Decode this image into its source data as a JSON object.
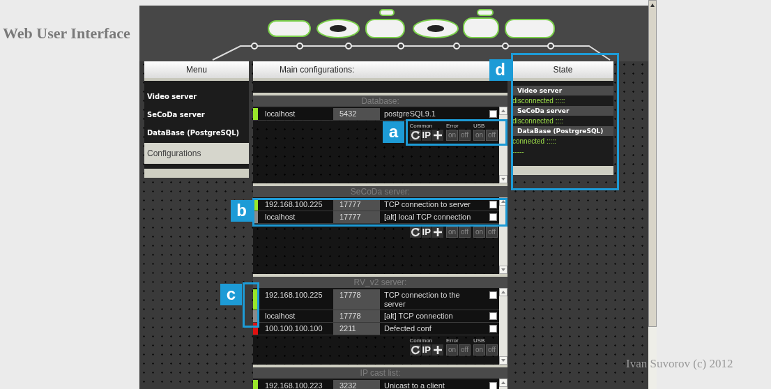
{
  "page_title": "Web User Interface",
  "menu": {
    "title": "Menu",
    "items": [
      {
        "label": "Video server",
        "selected": false
      },
      {
        "label": "SeCoDa server",
        "selected": false
      },
      {
        "label": "DataBase (PostgreSQL)",
        "selected": false
      },
      {
        "label": "Configurations",
        "selected": true
      }
    ]
  },
  "main": {
    "title": "Main configurations:",
    "sections": [
      {
        "title": "Database:",
        "rows": [
          {
            "color": "#99e62a",
            "ip": "localhost",
            "port": "5432",
            "description": "postgreSQL9.1",
            "checked": false
          }
        ],
        "control_groups": [
          {
            "label": "Common",
            "buttons": [
              {
                "kind": "refresh"
              },
              {
                "kind": "ip",
                "label": "IP"
              },
              {
                "kind": "add"
              }
            ]
          },
          {
            "label": "Error",
            "buttons": [
              {
                "kind": "toggle",
                "label": "on"
              },
              {
                "kind": "toggle",
                "label": "off"
              }
            ]
          },
          {
            "label": "USB",
            "buttons": [
              {
                "kind": "toggle",
                "label": "on"
              },
              {
                "kind": "toggle",
                "label": "off"
              }
            ]
          }
        ]
      },
      {
        "title": "SeCoDa server:",
        "rows": [
          {
            "color": "#99e62a",
            "ip": "192.168.100.225",
            "port": "17777",
            "description": "TCP connection to server",
            "checked": false
          },
          {
            "color": "#8a8a8a",
            "ip": "localhost",
            "port": "17777",
            "description": "[alt] local TCP connection",
            "checked": false
          }
        ],
        "control_groups": [
          {
            "buttons": [
              {
                "kind": "refresh"
              },
              {
                "kind": "ip",
                "label": "IP"
              },
              {
                "kind": "add"
              }
            ]
          },
          {
            "buttons": [
              {
                "kind": "toggle",
                "label": "on"
              },
              {
                "kind": "toggle",
                "label": "off"
              }
            ]
          },
          {
            "buttons": [
              {
                "kind": "toggle",
                "label": "on"
              },
              {
                "kind": "toggle",
                "label": "off"
              }
            ]
          }
        ]
      },
      {
        "title": "RV_v2 server:",
        "rows": [
          {
            "color": "#99e62a",
            "ip": "192.168.100.225",
            "port": "17778",
            "description": "TCP connection to the server",
            "checked": false
          },
          {
            "color": "#8a8a8a",
            "ip": "localhost",
            "port": "17778",
            "description": "[alt] TCP connection",
            "checked": false
          },
          {
            "color": "#e01010",
            "ip": "100.100.100.100",
            "port": "2211",
            "description": "Defected conf",
            "checked": false
          }
        ],
        "control_groups": [
          {
            "label": "Common",
            "buttons": [
              {
                "kind": "refresh"
              },
              {
                "kind": "ip",
                "label": "IP"
              },
              {
                "kind": "add"
              }
            ]
          },
          {
            "label": "Error",
            "buttons": [
              {
                "kind": "toggle",
                "label": "on"
              },
              {
                "kind": "toggle",
                "label": "off"
              }
            ]
          },
          {
            "label": "USB",
            "buttons": [
              {
                "kind": "toggle",
                "label": "on"
              },
              {
                "kind": "toggle",
                "label": "off"
              }
            ]
          }
        ]
      },
      {
        "title": "IP cast list:",
        "rows": [
          {
            "color": "#99e62a",
            "ip": "192.168.100.223",
            "port": "3232",
            "description": "Unicast to a client",
            "checked": false
          }
        ]
      }
    ]
  },
  "state": {
    "title": "State",
    "items": [
      {
        "name": "Video server",
        "status": "disconnected :::::"
      },
      {
        "name": "SeCoDa server",
        "status": "disconnected ::::"
      },
      {
        "name": "DataBase (PostrgreSQL)",
        "status": "connected :::::"
      },
      {
        "status": "-----"
      }
    ]
  },
  "callouts": [
    {
      "label": "a"
    },
    {
      "label": "b"
    },
    {
      "label": "c"
    },
    {
      "label": "d"
    }
  ],
  "footer": "Ivan Suvorov (c) 2012"
}
